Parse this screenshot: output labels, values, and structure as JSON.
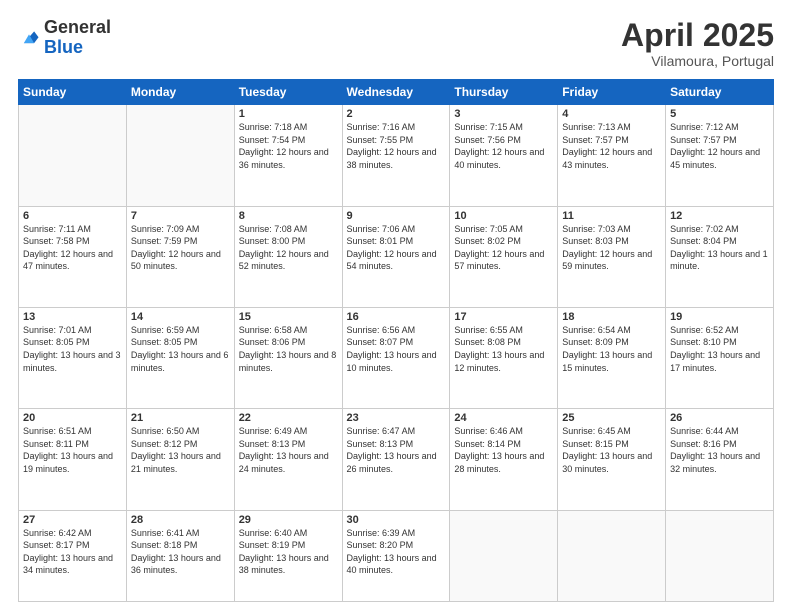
{
  "header": {
    "logo_general": "General",
    "logo_blue": "Blue",
    "month_title": "April 2025",
    "location": "Vilamoura, Portugal"
  },
  "weekdays": [
    "Sunday",
    "Monday",
    "Tuesday",
    "Wednesday",
    "Thursday",
    "Friday",
    "Saturday"
  ],
  "weeks": [
    [
      {
        "day": "",
        "info": ""
      },
      {
        "day": "",
        "info": ""
      },
      {
        "day": "1",
        "info": "Sunrise: 7:18 AM\nSunset: 7:54 PM\nDaylight: 12 hours and 36 minutes."
      },
      {
        "day": "2",
        "info": "Sunrise: 7:16 AM\nSunset: 7:55 PM\nDaylight: 12 hours and 38 minutes."
      },
      {
        "day": "3",
        "info": "Sunrise: 7:15 AM\nSunset: 7:56 PM\nDaylight: 12 hours and 40 minutes."
      },
      {
        "day": "4",
        "info": "Sunrise: 7:13 AM\nSunset: 7:57 PM\nDaylight: 12 hours and 43 minutes."
      },
      {
        "day": "5",
        "info": "Sunrise: 7:12 AM\nSunset: 7:57 PM\nDaylight: 12 hours and 45 minutes."
      }
    ],
    [
      {
        "day": "6",
        "info": "Sunrise: 7:11 AM\nSunset: 7:58 PM\nDaylight: 12 hours and 47 minutes."
      },
      {
        "day": "7",
        "info": "Sunrise: 7:09 AM\nSunset: 7:59 PM\nDaylight: 12 hours and 50 minutes."
      },
      {
        "day": "8",
        "info": "Sunrise: 7:08 AM\nSunset: 8:00 PM\nDaylight: 12 hours and 52 minutes."
      },
      {
        "day": "9",
        "info": "Sunrise: 7:06 AM\nSunset: 8:01 PM\nDaylight: 12 hours and 54 minutes."
      },
      {
        "day": "10",
        "info": "Sunrise: 7:05 AM\nSunset: 8:02 PM\nDaylight: 12 hours and 57 minutes."
      },
      {
        "day": "11",
        "info": "Sunrise: 7:03 AM\nSunset: 8:03 PM\nDaylight: 12 hours and 59 minutes."
      },
      {
        "day": "12",
        "info": "Sunrise: 7:02 AM\nSunset: 8:04 PM\nDaylight: 13 hours and 1 minute."
      }
    ],
    [
      {
        "day": "13",
        "info": "Sunrise: 7:01 AM\nSunset: 8:05 PM\nDaylight: 13 hours and 3 minutes."
      },
      {
        "day": "14",
        "info": "Sunrise: 6:59 AM\nSunset: 8:05 PM\nDaylight: 13 hours and 6 minutes."
      },
      {
        "day": "15",
        "info": "Sunrise: 6:58 AM\nSunset: 8:06 PM\nDaylight: 13 hours and 8 minutes."
      },
      {
        "day": "16",
        "info": "Sunrise: 6:56 AM\nSunset: 8:07 PM\nDaylight: 13 hours and 10 minutes."
      },
      {
        "day": "17",
        "info": "Sunrise: 6:55 AM\nSunset: 8:08 PM\nDaylight: 13 hours and 12 minutes."
      },
      {
        "day": "18",
        "info": "Sunrise: 6:54 AM\nSunset: 8:09 PM\nDaylight: 13 hours and 15 minutes."
      },
      {
        "day": "19",
        "info": "Sunrise: 6:52 AM\nSunset: 8:10 PM\nDaylight: 13 hours and 17 minutes."
      }
    ],
    [
      {
        "day": "20",
        "info": "Sunrise: 6:51 AM\nSunset: 8:11 PM\nDaylight: 13 hours and 19 minutes."
      },
      {
        "day": "21",
        "info": "Sunrise: 6:50 AM\nSunset: 8:12 PM\nDaylight: 13 hours and 21 minutes."
      },
      {
        "day": "22",
        "info": "Sunrise: 6:49 AM\nSunset: 8:13 PM\nDaylight: 13 hours and 24 minutes."
      },
      {
        "day": "23",
        "info": "Sunrise: 6:47 AM\nSunset: 8:13 PM\nDaylight: 13 hours and 26 minutes."
      },
      {
        "day": "24",
        "info": "Sunrise: 6:46 AM\nSunset: 8:14 PM\nDaylight: 13 hours and 28 minutes."
      },
      {
        "day": "25",
        "info": "Sunrise: 6:45 AM\nSunset: 8:15 PM\nDaylight: 13 hours and 30 minutes."
      },
      {
        "day": "26",
        "info": "Sunrise: 6:44 AM\nSunset: 8:16 PM\nDaylight: 13 hours and 32 minutes."
      }
    ],
    [
      {
        "day": "27",
        "info": "Sunrise: 6:42 AM\nSunset: 8:17 PM\nDaylight: 13 hours and 34 minutes."
      },
      {
        "day": "28",
        "info": "Sunrise: 6:41 AM\nSunset: 8:18 PM\nDaylight: 13 hours and 36 minutes."
      },
      {
        "day": "29",
        "info": "Sunrise: 6:40 AM\nSunset: 8:19 PM\nDaylight: 13 hours and 38 minutes."
      },
      {
        "day": "30",
        "info": "Sunrise: 6:39 AM\nSunset: 8:20 PM\nDaylight: 13 hours and 40 minutes."
      },
      {
        "day": "",
        "info": ""
      },
      {
        "day": "",
        "info": ""
      },
      {
        "day": "",
        "info": ""
      }
    ]
  ]
}
